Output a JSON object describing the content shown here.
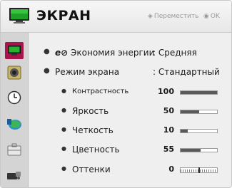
{
  "header": {
    "title": "ЭКРАН",
    "hint_move": "Переместить",
    "hint_ok": "OK"
  },
  "sidebar": {
    "items": [
      {
        "icon": "picture-icon",
        "active": true
      },
      {
        "icon": "speaker-icon",
        "active": false
      },
      {
        "icon": "clock-icon",
        "active": false
      },
      {
        "icon": "network-icon",
        "active": false
      },
      {
        "icon": "lock-icon",
        "active": false
      },
      {
        "icon": "input-icon",
        "active": false
      }
    ]
  },
  "settings": {
    "energy": {
      "label": "Экономия энергии",
      "value": "Средняя"
    },
    "mode": {
      "label": "Режим экрана",
      "value": "Стандартный"
    },
    "contrast": {
      "label": "Контрастность",
      "value": "100",
      "level": 100
    },
    "brightness": {
      "label": "Яркость",
      "value": "50",
      "level": 50
    },
    "sharpness": {
      "label": "Четкость",
      "value": "10",
      "level": 20
    },
    "color": {
      "label": "Цветность",
      "value": "55",
      "level": 55
    },
    "tint": {
      "label": "Оттенки",
      "value": "0"
    }
  },
  "colors": {
    "accent": "#a8154a",
    "bar_fill": "#5a5a5a"
  }
}
